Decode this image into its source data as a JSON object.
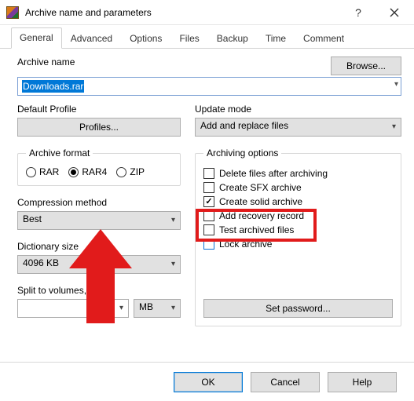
{
  "window": {
    "title": "Archive name and parameters"
  },
  "tabs": [
    "General",
    "Advanced",
    "Options",
    "Files",
    "Backup",
    "Time",
    "Comment"
  ],
  "active_tab": 0,
  "archive_name": {
    "label": "Archive name",
    "value": "Downloads.rar",
    "browse": "Browse..."
  },
  "default_profile": {
    "label": "Default Profile",
    "button": "Profiles..."
  },
  "update_mode": {
    "label": "Update mode",
    "value": "Add and replace files"
  },
  "archive_format": {
    "legend": "Archive format",
    "options": [
      "RAR",
      "RAR4",
      "ZIP"
    ],
    "selected": 1
  },
  "compression": {
    "label": "Compression method",
    "value": "Best"
  },
  "dictionary": {
    "label": "Dictionary size",
    "value": "4096 KB"
  },
  "split": {
    "label": "Split to volumes, size",
    "value": "",
    "unit": "MB"
  },
  "archiving_options": {
    "legend": "Archiving options",
    "items": [
      {
        "label": "Delete files after archiving",
        "checked": false,
        "blue": false
      },
      {
        "label": "Create SFX archive",
        "checked": false,
        "blue": false
      },
      {
        "label": "Create solid archive",
        "checked": true,
        "blue": false
      },
      {
        "label": "Add recovery record",
        "checked": false,
        "blue": false
      },
      {
        "label": "Test archived files",
        "checked": false,
        "blue": false
      },
      {
        "label": "Lock archive",
        "checked": false,
        "blue": true
      }
    ],
    "set_password": "Set password..."
  },
  "footer": {
    "ok": "OK",
    "cancel": "Cancel",
    "help": "Help"
  }
}
